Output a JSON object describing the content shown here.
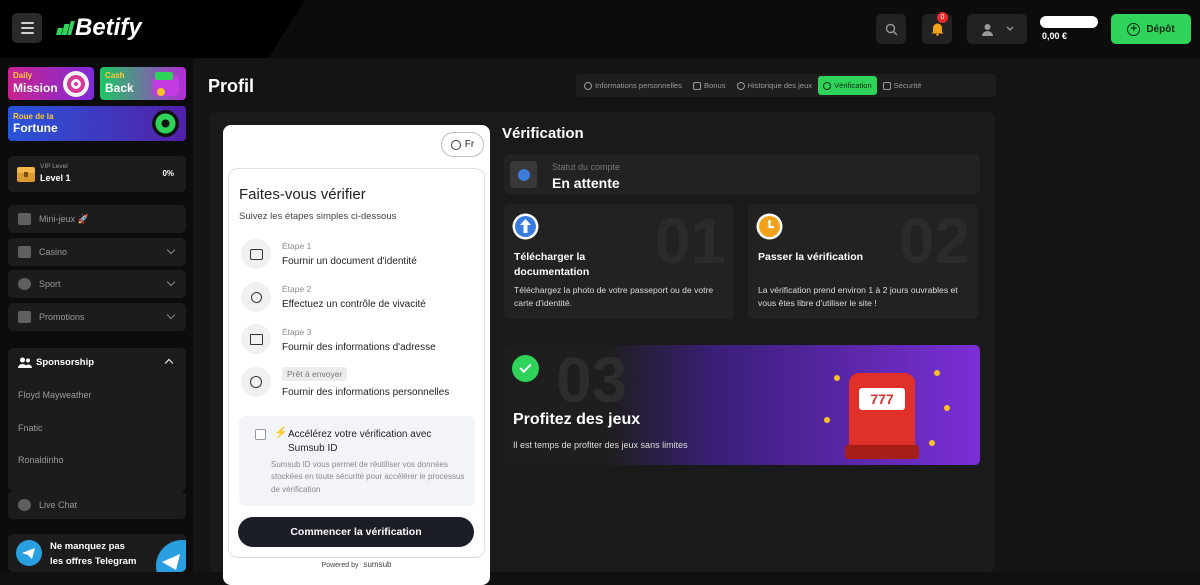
{
  "header": {
    "brand": "Betify",
    "notifications_count": "0",
    "balance": "0,00 €",
    "deposit_label": "Dépôt"
  },
  "sidebar": {
    "promos": {
      "daily_small": "Daily",
      "daily_big": "Mission",
      "cash_small": "Cash",
      "cash_big": "Back",
      "fortune_small": "Roue de la",
      "fortune_big": "Fortune"
    },
    "vip": {
      "label": "VIP Level",
      "level": "Level 1",
      "progress": "0%"
    },
    "nav": [
      {
        "label": "Mini-jeux 🚀"
      },
      {
        "label": "Casino"
      },
      {
        "label": "Sport"
      },
      {
        "label": "Promotions"
      }
    ],
    "sponsorship": {
      "label": "Sponsorship",
      "items": [
        "Floyd Mayweather",
        "Fnatic",
        "Ronaldinho"
      ]
    },
    "live_chat": "Live Chat",
    "telegram": {
      "line1": "Ne manquez pas",
      "line2": "les offres Telegram"
    }
  },
  "main": {
    "title": "Profil",
    "tabs": [
      {
        "label": "Informations personnelles"
      },
      {
        "label": "Bonus"
      },
      {
        "label": "Historique des jeux"
      },
      {
        "label": "Vérification"
      },
      {
        "label": "Sécurité"
      }
    ],
    "active_tab": "Vérification",
    "sumsub": {
      "lang": "Fr",
      "title": "Faites-vous vérifier",
      "subtitle": "Suivez les étapes simples ci-dessous",
      "steps": [
        {
          "label": "Étape 1",
          "text": "Fournir un document d'identité"
        },
        {
          "label": "Étape 2",
          "text": "Effectuez un contrôle de vivacité"
        },
        {
          "label": "Étape 3",
          "text": "Fournir des informations d'adresse"
        },
        {
          "label": "Prêt à envoyer",
          "text": "Fournir des informations personnelles"
        }
      ],
      "speed_title": "Accélérez votre vérification avec Sumsub ID",
      "speed_desc": "Sumsub ID vous permet de réutiliser vos données stockées en toute sécurité pour accélérer le processus de vérification",
      "start_label": "Commencer la vérification",
      "powered_by": "Powered by",
      "powered_brand": "sumsub"
    },
    "verification": {
      "title": "Vérification",
      "status_label": "Statut du compte",
      "status_value": "En attente",
      "cards": [
        {
          "num": "01",
          "title": "Télécharger la documentation",
          "desc": "Téléchargez la photo de votre passeport ou de votre carte d'identité."
        },
        {
          "num": "02",
          "title": "Passer la vérification",
          "desc": "La vérification prend environ 1 à 2 jours ouvrables et vous êtes libre d'utiliser le site !"
        },
        {
          "num": "03",
          "title": "Profitez des jeux",
          "desc": "Il est temps de profiter des jeux sans limites"
        }
      ],
      "slot_digits": "777"
    }
  },
  "colors": {
    "accent": "#2fd35a",
    "card3_gradient": "#7b2fd6"
  }
}
